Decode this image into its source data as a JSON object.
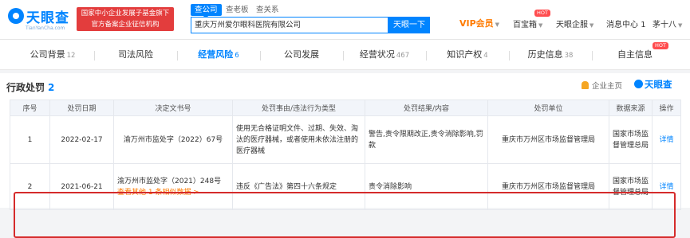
{
  "header": {
    "logo_text": "天眼查",
    "logo_sub": "TianYanCha.com",
    "gov_badge_line1": "国家中小企业发展子基金旗下",
    "gov_badge_line2": "官方备案企业征信机构",
    "search_tabs": [
      "查公司",
      "查老板",
      "查关系"
    ],
    "search_value": "重庆万州爱尔眼科医院有限公司",
    "search_button": "天眼一下",
    "nav": {
      "vip": "VIP会员",
      "baibaoxiang": "百宝箱",
      "hot": "HOT",
      "qiye": "天眼企服",
      "message": "消息中心",
      "message_count": "1",
      "user": "茅十八"
    }
  },
  "tabs": [
    {
      "label": "公司背景",
      "count": "12"
    },
    {
      "label": "司法风险",
      "count": ""
    },
    {
      "label": "经营风险",
      "count": "6"
    },
    {
      "label": "公司发展",
      "count": ""
    },
    {
      "label": "经营状况",
      "count": "467"
    },
    {
      "label": "知识产权",
      "count": "4"
    },
    {
      "label": "历史信息",
      "count": "38"
    },
    {
      "label": "自主信息",
      "count": "",
      "badge": "HOT"
    }
  ],
  "section": {
    "title": "行政处罚",
    "count": "2",
    "alert": "企业主页",
    "brand": "天眼查"
  },
  "table": {
    "headers": [
      "序号",
      "处罚日期",
      "决定文书号",
      "处罚事由/违法行为类型",
      "处罚结果/内容",
      "处罚单位",
      "数据来源",
      "操作"
    ],
    "rows": [
      {
        "index": "1",
        "date": "2022-02-17",
        "doc": "渝万州市监处字（2022）67号",
        "reason": "使用无合格证明文件、过期、失效、淘汰的医疗器械，或者使用未依法注册的医疗器械",
        "result": "警告,责令限期改正,责令消除影响,罚款",
        "unit": "重庆市万州区市场监督管理局",
        "source": "国家市场监督管理总局",
        "action": "详情"
      },
      {
        "index": "2",
        "date": "2021-06-21",
        "doc": "渝万州市监处字（2021）248号",
        "doc_more": "查看其他 1 条相似数据 >",
        "reason": "违反《广告法》第四十六条规定",
        "result": "责令消除影响",
        "unit": "重庆市万州区市场监督管理局",
        "source": "国家市场监督管理总局",
        "action": "详情"
      }
    ]
  },
  "colors": {
    "brand_blue": "#0084ff",
    "vip_orange": "#ff7b00",
    "highlight_red": "#d52b2b",
    "gov_red": "#e33d3d"
  }
}
